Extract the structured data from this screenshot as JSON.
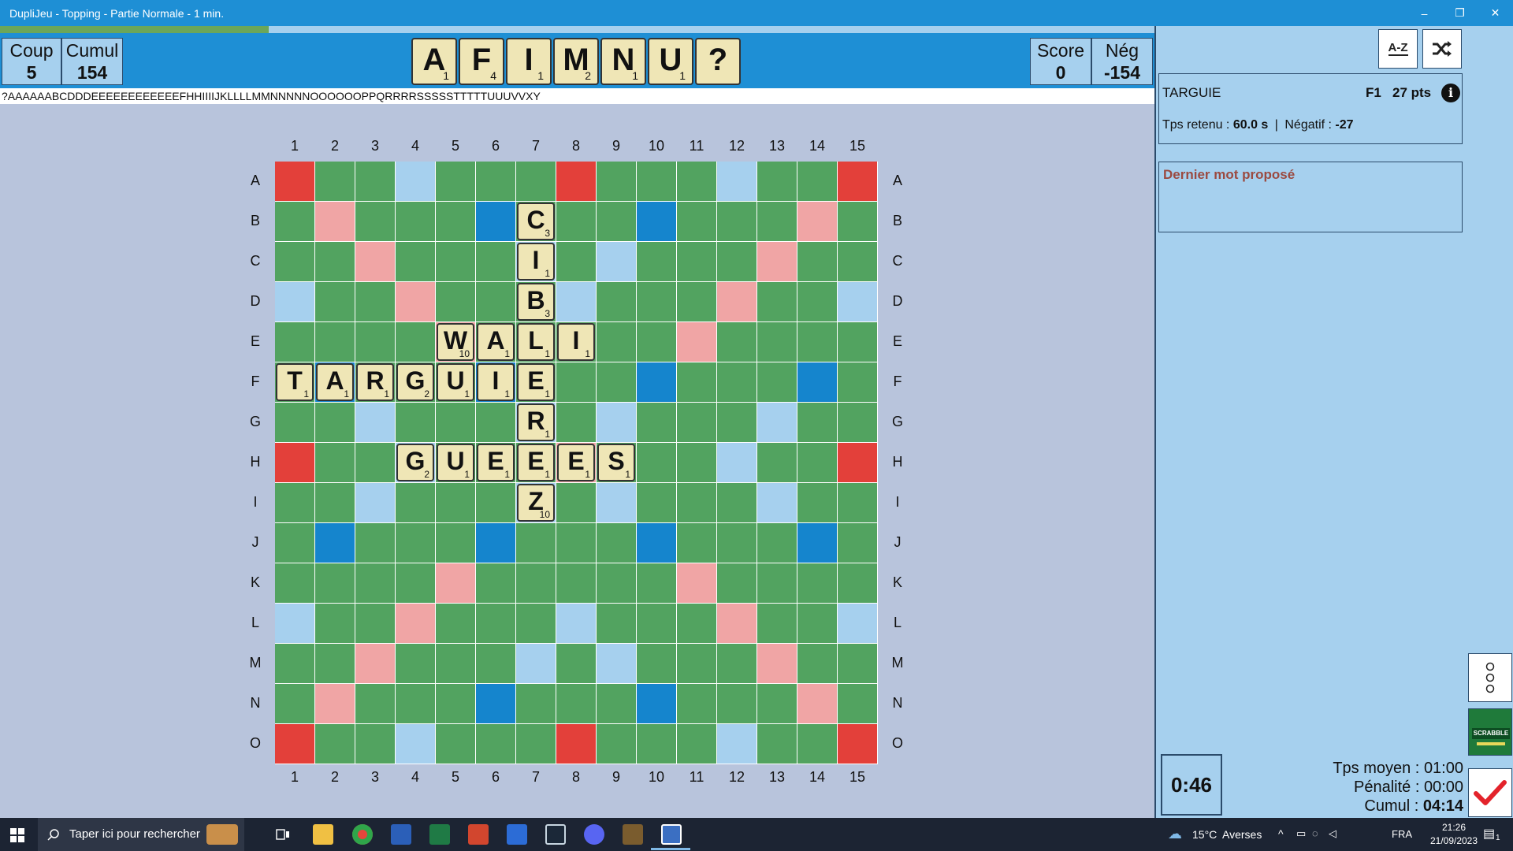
{
  "window": {
    "title": "DupliJeu - Topping - Partie Normale - 1 min.",
    "minimize": "–",
    "maximize": "❐",
    "close": "✕"
  },
  "progress": {
    "fraction": 0.233
  },
  "stats": {
    "coup_label": "Coup",
    "coup_value": "5",
    "cumul_label": "Cumul",
    "cumul_value": "154",
    "score_label": "Score",
    "score_value": "0",
    "neg_label": "Nég",
    "neg_value": "-154"
  },
  "rack": [
    {
      "letter": "A",
      "points": "1"
    },
    {
      "letter": "F",
      "points": "4"
    },
    {
      "letter": "I",
      "points": "1"
    },
    {
      "letter": "M",
      "points": "2"
    },
    {
      "letter": "N",
      "points": "1"
    },
    {
      "letter": "U",
      "points": "1"
    },
    {
      "letter": "?",
      "points": ""
    }
  ],
  "bag_letters": "?AAAAAABCDDDEEEEEEEEEEEEFHHIIIIJKLLLLMMNNNNNOOOOOOPPQRRRRSSSSSTTTTTUUUVVXY",
  "board": {
    "col_labels": [
      "1",
      "2",
      "3",
      "4",
      "5",
      "6",
      "7",
      "8",
      "9",
      "10",
      "11",
      "12",
      "13",
      "14",
      "15"
    ],
    "row_labels": [
      "A",
      "B",
      "C",
      "D",
      "E",
      "F",
      "G",
      "H",
      "I",
      "J",
      "K",
      "L",
      "M",
      "N",
      "O"
    ],
    "premium_grid": [
      "T..d...T...d..T",
      ".D...t...t...D.",
      "..D...d.d...D..",
      "d..D...d...D..d",
      "....D.....D....",
      ".t...t...t...t.",
      "..d...d.d...d..",
      "T..d...D...d..T",
      "..d...d.d...d..",
      ".t...t...t...t.",
      "....D.....D....",
      "d..D...d...D..d",
      "..D...d.d...D..",
      ".D...t...t...D.",
      "T..d...T...d..T"
    ],
    "tiles": [
      {
        "row": "B",
        "col": 7,
        "letter": "C",
        "points": "3"
      },
      {
        "row": "C",
        "col": 7,
        "letter": "I",
        "points": "1"
      },
      {
        "row": "D",
        "col": 7,
        "letter": "B",
        "points": "3"
      },
      {
        "row": "E",
        "col": 5,
        "letter": "W",
        "points": "10"
      },
      {
        "row": "E",
        "col": 6,
        "letter": "A",
        "points": "1"
      },
      {
        "row": "E",
        "col": 7,
        "letter": "L",
        "points": "1"
      },
      {
        "row": "E",
        "col": 8,
        "letter": "I",
        "points": "1"
      },
      {
        "row": "F",
        "col": 1,
        "letter": "T",
        "points": "1"
      },
      {
        "row": "F",
        "col": 2,
        "letter": "A",
        "points": "1"
      },
      {
        "row": "F",
        "col": 3,
        "letter": "R",
        "points": "1"
      },
      {
        "row": "F",
        "col": 4,
        "letter": "G",
        "points": "2"
      },
      {
        "row": "F",
        "col": 5,
        "letter": "U",
        "points": "1"
      },
      {
        "row": "F",
        "col": 6,
        "letter": "I",
        "points": "1"
      },
      {
        "row": "F",
        "col": 7,
        "letter": "E",
        "points": "1"
      },
      {
        "row": "G",
        "col": 7,
        "letter": "R",
        "points": "1"
      },
      {
        "row": "H",
        "col": 4,
        "letter": "G",
        "points": "2"
      },
      {
        "row": "H",
        "col": 5,
        "letter": "U",
        "points": "1"
      },
      {
        "row": "H",
        "col": 6,
        "letter": "E",
        "points": "1"
      },
      {
        "row": "H",
        "col": 7,
        "letter": "E",
        "points": "1"
      },
      {
        "row": "H",
        "col": 8,
        "letter": "E",
        "points": "1"
      },
      {
        "row": "H",
        "col": 9,
        "letter": "S",
        "points": "1"
      },
      {
        "row": "I",
        "col": 7,
        "letter": "Z",
        "points": "10"
      }
    ]
  },
  "side": {
    "sort_button": "A-Z",
    "last_word": {
      "word": "TARGUIE",
      "position": "F1",
      "points": "27 pts",
      "tps_label": "Tps retenu :",
      "tps_value": "60.0 s",
      "sep": "|",
      "neg_label": "Négatif :",
      "neg_value": "-27"
    },
    "proposed_title": "Dernier mot proposé",
    "timer": "0:46",
    "summary": {
      "tps_moyen_label": "Tps moyen :",
      "tps_moyen_value": "01:00",
      "penalite_label": "Pénalité :",
      "penalite_value": "00:00",
      "cumul_label": "Cumul :",
      "cumul_value": "04:14"
    },
    "scrabble_logo": "SCRABBLE"
  },
  "taskbar": {
    "search_placeholder": "Taper ici pour rechercher",
    "weather_temp": "15°C",
    "weather_desc": "Averses",
    "lang": "FRA",
    "time": "21:26",
    "date": "21/09/2023",
    "notif_count": "1"
  },
  "colors": {
    "board_green": "#52a360",
    "triple_word": "#e3403a",
    "double_word": "#f0a5a5",
    "triple_letter": "#1585cd",
    "double_letter": "#a6d0ee",
    "tile": "#efe6b6"
  }
}
